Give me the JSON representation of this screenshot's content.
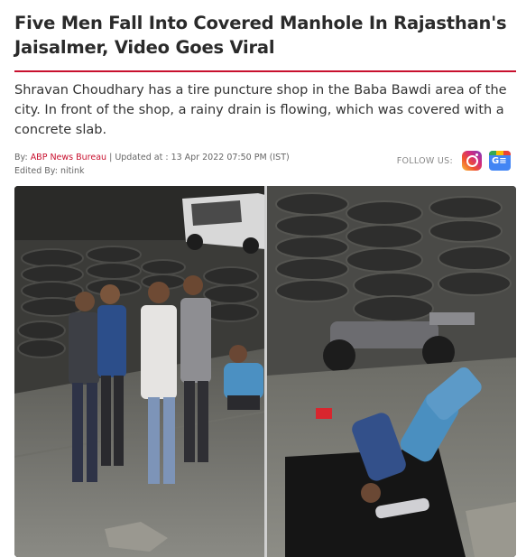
{
  "article": {
    "headline": "Five Men Fall Into Covered Manhole In Rajasthan's Jaisalmer, Video Goes Viral",
    "summary": "Shravan Choudhary has a tire puncture shop in the Baba Bawdi area of the city. In front of the shop, a rainy drain is flowing, which was covered with a concrete slab.",
    "byline_prefix": "By:",
    "author": "ABP News Bureau",
    "separator": " | ",
    "updated": "Updated at : 13 Apr 2022 07:50 PM (IST)",
    "edited_by": "Edited By: nitink"
  },
  "follow": {
    "label": "FOLLOW US:",
    "instagram_icon": "instagram-icon",
    "google_news_icon": "google-news-icon",
    "google_news_text": "G≡"
  },
  "media": {
    "left_panel": "cctv-frame-men-standing-near-tires",
    "right_panel": "cctv-frame-men-falling-into-manhole"
  },
  "colors": {
    "accent": "#c8102e",
    "headline": "#2a2a2a",
    "body": "#333333"
  }
}
